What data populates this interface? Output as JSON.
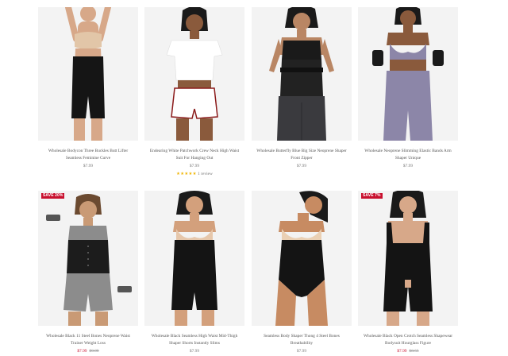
{
  "colors": {
    "sale_red": "#c8102e",
    "star_gold": "#f0b400",
    "image_bg": "#f3f3f3"
  },
  "products": [
    {
      "title": "Wholesale Bodycon Three Buckles Butt Lifter Seamless Feminine Curve",
      "price": "$7.99",
      "image_icon": "model-beige-bra-black-shorts-icon"
    },
    {
      "title": "Endearing White Patchwork Crew Neck High Waist Suit For Hanging Out",
      "price": "$7.99",
      "rating_stars": "★★★★★",
      "rating_text": "1 review",
      "image_icon": "model-white-tee-shorts-icon"
    },
    {
      "title": "Wholesale Butterfly Blue Big Size Neoprene Shaper Front Zipper",
      "price": "$7.99",
      "image_icon": "model-black-waist-trainer-icon"
    },
    {
      "title": "Wholesale Neoprene Slimming Elastic Bands Arm Shaper Unique",
      "price": "$7.99",
      "image_icon": "model-lavender-set-icon"
    },
    {
      "badge": "SAVE 20%",
      "title": "Wholesale Black 11 Steel Bones Neoprene Waist Trainer Weight Loss",
      "price_sale": "$7.99",
      "price_orig": "$9.99",
      "image_icon": "model-grey-set-waist-trainer-icon"
    },
    {
      "title": "Wholesale Black Seamless High Waist Mid-Thigh Shaper Shorts Instantly Slims",
      "price": "$7.99",
      "image_icon": "model-black-high-waist-shorts-icon"
    },
    {
      "title": "Seamless Body Shaper Thong 4 Steel Bones Breathability",
      "price": "$7.99",
      "image_icon": "model-black-shaper-thong-icon"
    },
    {
      "badge": "SAVE 7%",
      "title": "Wholesale Black Open Crotch Seamless Shapewear Bodysuit Hourglass Figure",
      "price_sale": "$7.99",
      "price_orig": "$8.55",
      "image_icon": "model-black-open-bust-bodysuit-icon"
    }
  ]
}
